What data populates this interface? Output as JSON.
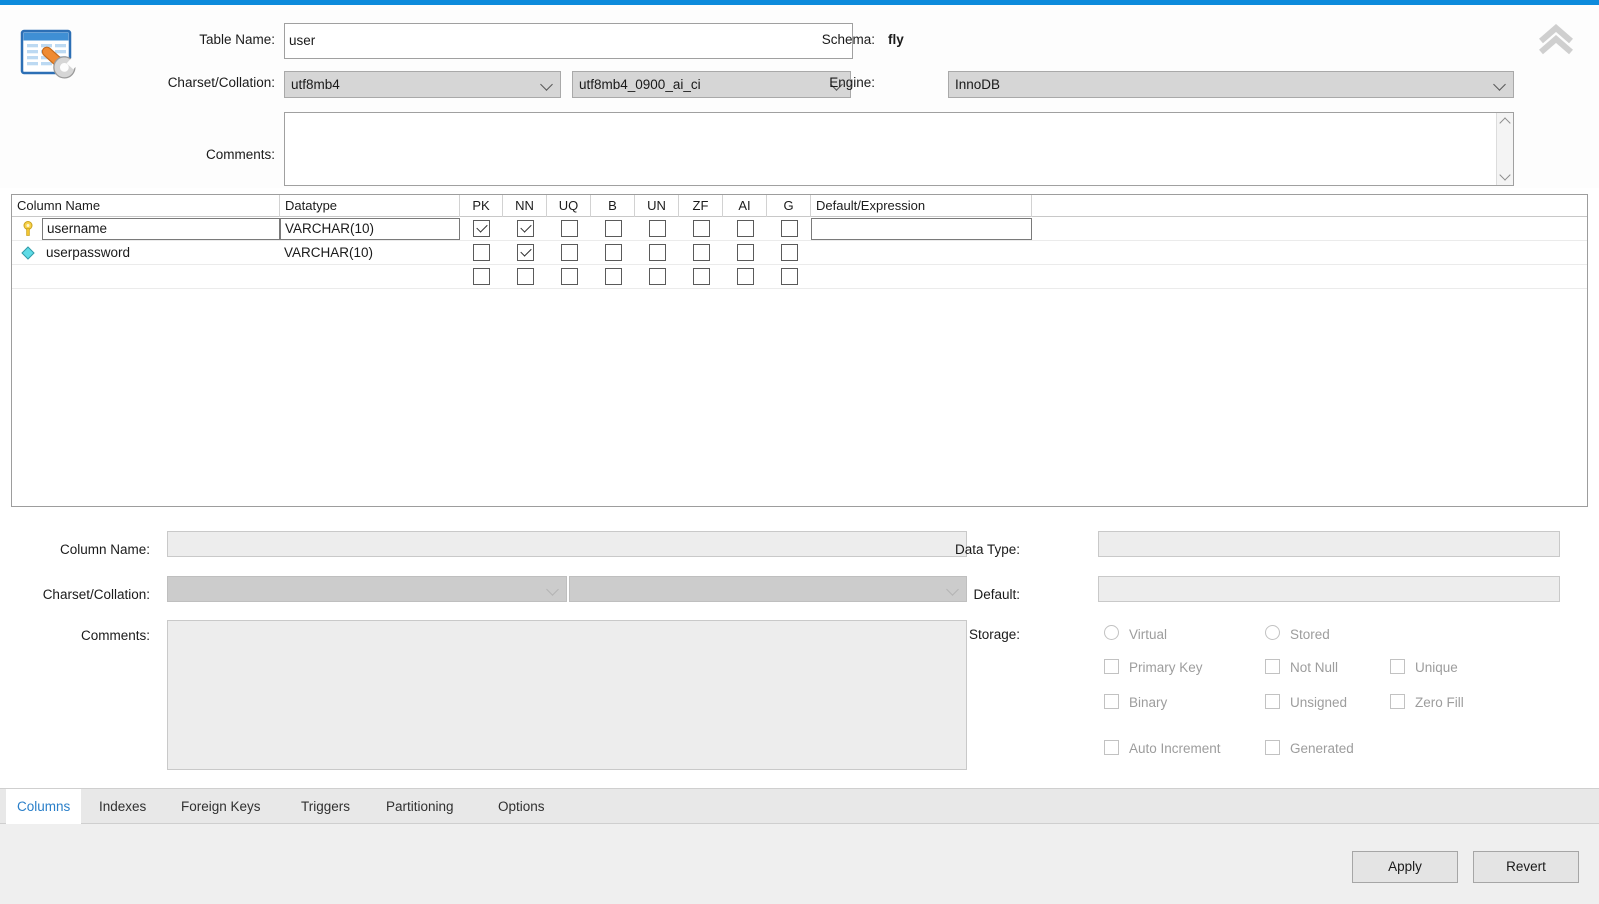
{
  "theme": {
    "accent_bar": "#0d8bdc",
    "active_tab_text": "#2a7fc9",
    "pk_icon_color": "#f5c518",
    "diamond_icon_color": "#4fd6e0"
  },
  "header": {
    "icon_name": "table-wrench-icon",
    "table_name_label": "Table Name:",
    "table_name_value": "user",
    "schema_label": "Schema:",
    "schema_value": "fly",
    "charset_label": "Charset/Collation:",
    "charset_value": "utf8mb4",
    "collation_value": "utf8mb4_0900_ai_ci",
    "engine_label": "Engine:",
    "engine_value": "InnoDB",
    "comments_label": "Comments:",
    "comments_value": "",
    "collapse_icon": "double-chevron-up-icon"
  },
  "grid": {
    "headers": [
      "Column Name",
      "Datatype",
      "PK",
      "NN",
      "UQ",
      "B",
      "UN",
      "ZF",
      "AI",
      "G",
      "Default/Expression"
    ],
    "rows": [
      {
        "icon": "primary-key-icon",
        "name": "username",
        "datatype": "VARCHAR(10)",
        "editing": true,
        "default": "",
        "flags": {
          "PK": true,
          "NN": true,
          "UQ": false,
          "B": false,
          "UN": false,
          "ZF": false,
          "AI": false,
          "G": false
        }
      },
      {
        "icon": "column-diamond-icon",
        "name": "userpassword",
        "datatype": "VARCHAR(10)",
        "editing": false,
        "default": "",
        "flags": {
          "PK": false,
          "NN": true,
          "UQ": false,
          "B": false,
          "UN": false,
          "ZF": false,
          "AI": false,
          "G": false
        }
      },
      {
        "icon": "",
        "name": "",
        "datatype": "",
        "editing": false,
        "default": "",
        "flags": {
          "PK": false,
          "NN": false,
          "UQ": false,
          "B": false,
          "UN": false,
          "ZF": false,
          "AI": false,
          "G": false
        }
      }
    ]
  },
  "detail": {
    "column_name_label": "Column Name:",
    "column_name_value": "",
    "charset_label": "Charset/Collation:",
    "charset_value": "",
    "collation_value": "",
    "comments_label": "Comments:",
    "comments_value": "",
    "data_type_label": "Data Type:",
    "data_type_value": "",
    "default_label": "Default:",
    "default_value": "",
    "storage_label": "Storage:",
    "radios": [
      {
        "label": "Virtual",
        "checked": false
      },
      {
        "label": "Stored",
        "checked": false
      }
    ],
    "checkboxes": [
      {
        "label": "Primary Key",
        "checked": false
      },
      {
        "label": "Not Null",
        "checked": false
      },
      {
        "label": "Unique",
        "checked": false
      },
      {
        "label": "Binary",
        "checked": false
      },
      {
        "label": "Unsigned",
        "checked": false
      },
      {
        "label": "Zero Fill",
        "checked": false
      },
      {
        "label": "Auto Increment",
        "checked": false
      },
      {
        "label": "Generated",
        "checked": false
      }
    ]
  },
  "tabs": [
    {
      "label": "Columns",
      "active": true
    },
    {
      "label": "Indexes",
      "active": false
    },
    {
      "label": "Foreign Keys",
      "active": false
    },
    {
      "label": "Triggers",
      "active": false
    },
    {
      "label": "Partitioning",
      "active": false
    },
    {
      "label": "Options",
      "active": false
    }
  ],
  "footer": {
    "apply_label": "Apply",
    "revert_label": "Revert"
  }
}
